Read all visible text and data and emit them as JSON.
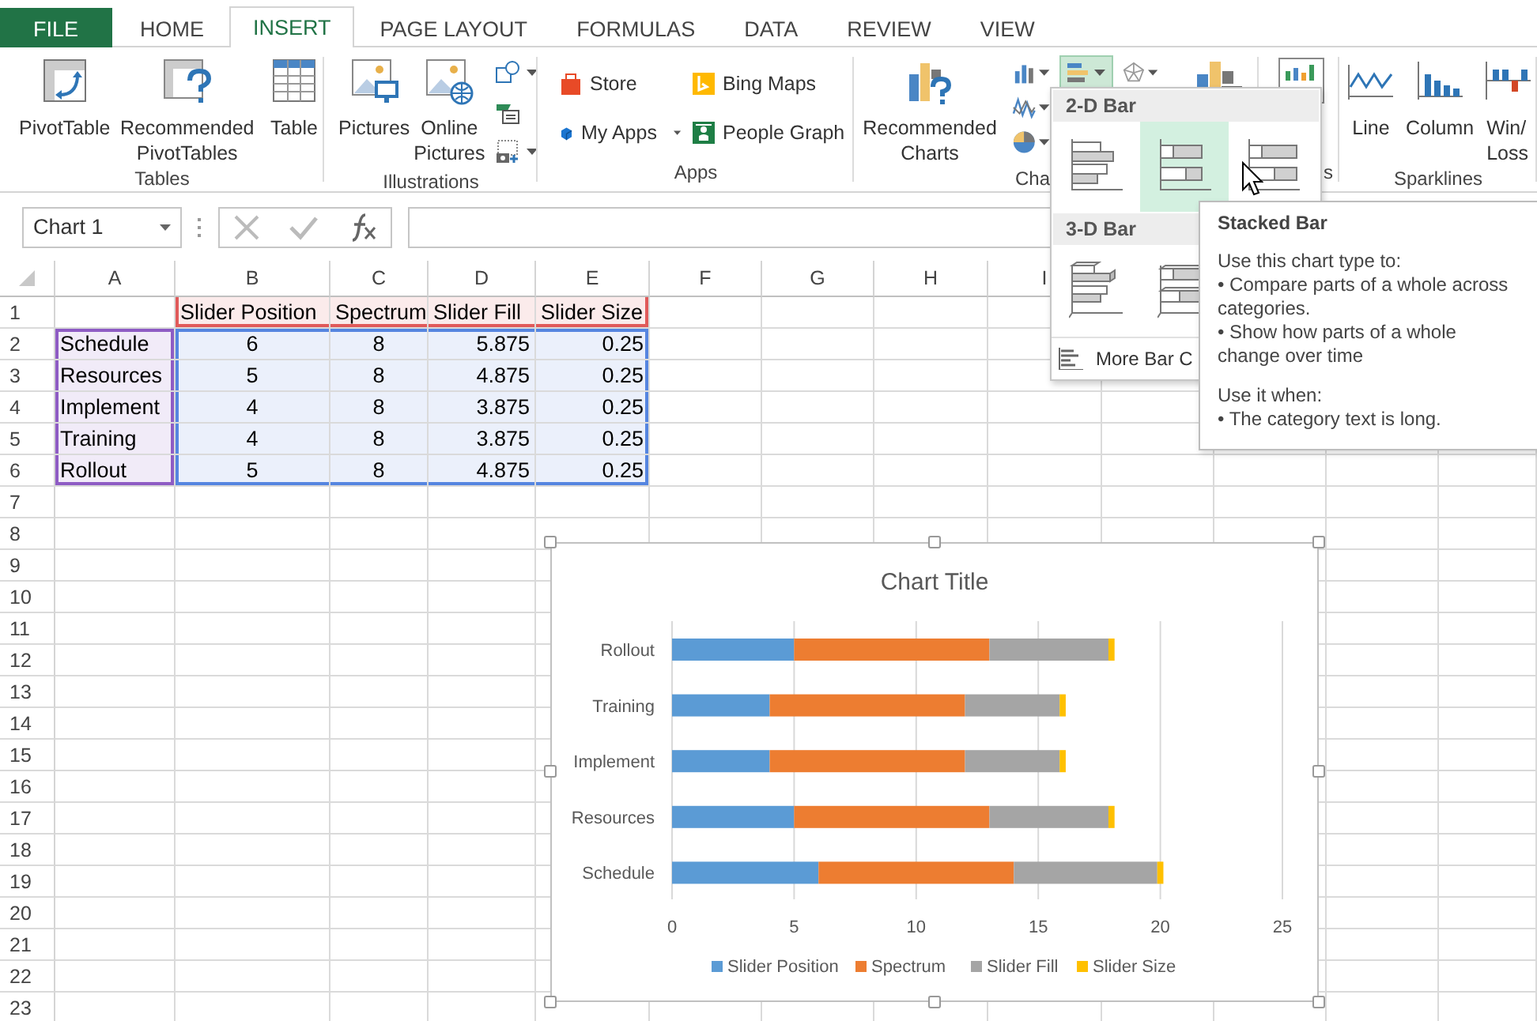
{
  "tabs": [
    {
      "label": "FILE",
      "kind": "file",
      "selected": false
    },
    {
      "label": "HOME",
      "kind": "tab",
      "selected": false
    },
    {
      "label": "INSERT",
      "kind": "tab",
      "selected": true
    },
    {
      "label": "PAGE LAYOUT",
      "kind": "tab",
      "selected": false
    },
    {
      "label": "FORMULAS",
      "kind": "tab",
      "selected": false
    },
    {
      "label": "DATA",
      "kind": "tab",
      "selected": false
    },
    {
      "label": "REVIEW",
      "kind": "tab",
      "selected": false
    },
    {
      "label": "VIEW",
      "kind": "tab",
      "selected": false
    }
  ],
  "ribbon": {
    "groups": [
      {
        "kind": "tables",
        "label": "Tables",
        "buttons": [
          {
            "kind": "pivot_table",
            "label": "PivotTable"
          },
          {
            "kind": "recommended_pivot_tables",
            "label": "Recommended PivotTables"
          },
          {
            "kind": "table",
            "label": "Table"
          }
        ]
      },
      {
        "kind": "illustrations",
        "label": "Illustrations",
        "buttons": [
          {
            "kind": "pictures",
            "label": "Pictures"
          },
          {
            "kind": "online_pictures",
            "label": "Online Pictures"
          }
        ]
      },
      {
        "kind": "apps",
        "label": "Apps",
        "buttons": [
          {
            "kind": "store",
            "label": "Store"
          },
          {
            "kind": "bing_maps",
            "label": "Bing Maps"
          },
          {
            "kind": "my_apps",
            "label": "My Apps"
          },
          {
            "kind": "people_graph",
            "label": "People Graph"
          }
        ]
      },
      {
        "kind": "charts",
        "label": "Cha",
        "buttons": [
          {
            "kind": "recommended_charts",
            "label": "Recommended Charts"
          }
        ],
        "chart_type_buttons": [
          {
            "kind": "column",
            "expanded": false
          },
          {
            "kind": "bar",
            "expanded": true
          },
          {
            "kind": "radar",
            "expanded": false
          },
          {
            "kind": "line",
            "expanded": false
          },
          {
            "kind": "pie",
            "expanded": false
          }
        ]
      },
      {
        "kind": "covered",
        "label": "s"
      },
      {
        "kind": "sparklines",
        "label": "Sparklines",
        "buttons": [
          {
            "kind": "spark_line",
            "label": "Line"
          },
          {
            "kind": "spark_column",
            "label": "Column"
          },
          {
            "kind": "win_loss",
            "label": "Win/Loss"
          }
        ]
      }
    ]
  },
  "formula_bar": {
    "name_box": "Chart 1"
  },
  "sheet": {
    "column_headers": [
      "A",
      "B",
      "C",
      "D",
      "E",
      "F",
      "G",
      "H",
      "I"
    ],
    "row_headers": [
      "1",
      "2",
      "3",
      "4",
      "5",
      "6",
      "7",
      "8",
      "9",
      "10",
      "11",
      "12",
      "13",
      "14",
      "15",
      "16",
      "17",
      "18",
      "19",
      "20",
      "21",
      "22",
      "23"
    ],
    "table": {
      "columns": [
        "Slider Position",
        "Spectrum",
        "Slider Fill",
        "Slider Size"
      ],
      "rows": [
        {
          "label": "Schedule",
          "values": [
            "6",
            "8",
            "5.875",
            "0.25"
          ]
        },
        {
          "label": "Resources",
          "values": [
            "5",
            "8",
            "4.875",
            "0.25"
          ]
        },
        {
          "label": "Implement",
          "values": [
            "4",
            "8",
            "3.875",
            "0.25"
          ]
        },
        {
          "label": "Training",
          "values": [
            "4",
            "8",
            "3.875",
            "0.25"
          ]
        },
        {
          "label": "Rollout",
          "values": [
            "5",
            "8",
            "4.875",
            "0.25"
          ]
        }
      ],
      "ranges": [
        {
          "kind": "series_names",
          "color": "#e05a5a"
        },
        {
          "kind": "categories",
          "color": "#8e5cc4"
        },
        {
          "kind": "values",
          "color": "#5585e0"
        }
      ]
    }
  },
  "chart": {
    "chart_data": {
      "type": "bar",
      "orientation": "horizontal",
      "stacked": true,
      "title": "Chart Title",
      "categories": [
        "Rollout",
        "Training",
        "Implement",
        "Resources",
        "Schedule"
      ],
      "series": [
        {
          "name": "Slider Position",
          "color": "#5b9bd5",
          "values": [
            5,
            4,
            4,
            5,
            6
          ]
        },
        {
          "name": "Spectrum",
          "color": "#ed7d31",
          "values": [
            8,
            8,
            8,
            8,
            8
          ]
        },
        {
          "name": "Slider Fill",
          "color": "#a5a5a5",
          "values": [
            4.875,
            3.875,
            3.875,
            4.875,
            5.875
          ]
        },
        {
          "name": "Slider Size",
          "color": "#ffc000",
          "values": [
            0.25,
            0.25,
            0.25,
            0.25,
            0.25
          ]
        }
      ],
      "xlim": [
        0,
        25
      ],
      "xticks": [
        0,
        5,
        10,
        15,
        20,
        25
      ],
      "grid": true,
      "legend": true
    }
  },
  "dropdown": {
    "sections": [
      {
        "title": "2-D Bar",
        "items": [
          {
            "kind": "clustered",
            "selected": false
          },
          {
            "kind": "stacked",
            "selected": true
          },
          {
            "kind": "percent_stacked",
            "selected": false
          }
        ]
      },
      {
        "title": "3-D Bar",
        "items": [
          {
            "kind": "clustered_3d",
            "selected": false
          },
          {
            "kind": "stacked_3d",
            "selected": false
          }
        ]
      }
    ],
    "more": "More Bar C"
  },
  "tooltip": {
    "title": "Stacked Bar",
    "paragraphs": [
      [
        "Use this chart type to:",
        "• Compare parts of a whole across categories.",
        "• Show how parts of a whole change over time"
      ],
      [
        "Use it when:",
        "• The category text is long."
      ]
    ]
  }
}
